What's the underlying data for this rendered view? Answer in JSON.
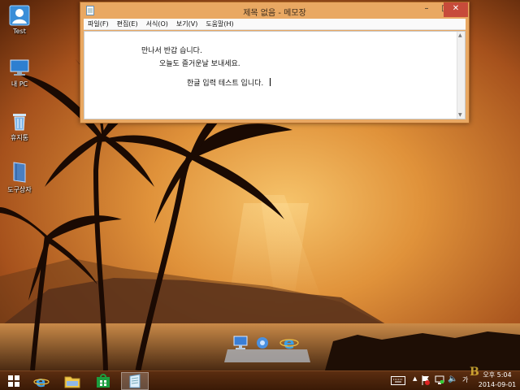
{
  "colors": {
    "window_frame": "#e9a862",
    "close_button": "#c74b3a",
    "taskbar": "#4a220a",
    "sky_glow": "#f4b04a"
  },
  "desktop": {
    "icons": [
      {
        "label": "Test",
        "icon": "user-icon"
      },
      {
        "label": "내 PC",
        "icon": "computer-icon"
      },
      {
        "label": "휴지통",
        "icon": "recycle-bin-icon"
      },
      {
        "label": "도구상자",
        "icon": "book-icon"
      }
    ]
  },
  "notepad": {
    "title": "제목 없음 - 메모장",
    "window_buttons": {
      "minimize": "–",
      "maximize": "□",
      "close": "✕"
    },
    "menu": [
      "파일(F)",
      "편집(E)",
      "서식(O)",
      "보기(V)",
      "도움말(H)"
    ],
    "lines": [
      "만나서 반갑 습니다.",
      "오늘도 즐거운날 보내세요.",
      "한글 입력 테스트 입니다."
    ]
  },
  "dock": {
    "icons": [
      "computer-icon",
      "gear-icon",
      "internet-explorer-icon"
    ]
  },
  "taskbar": {
    "pinned": [
      "windows-start-icon",
      "internet-explorer-icon",
      "file-explorer-icon",
      "store-icon",
      "notepad-icon"
    ],
    "tray": {
      "ime": "가",
      "time": "오후 5:04",
      "date": "2014-09-01"
    }
  }
}
